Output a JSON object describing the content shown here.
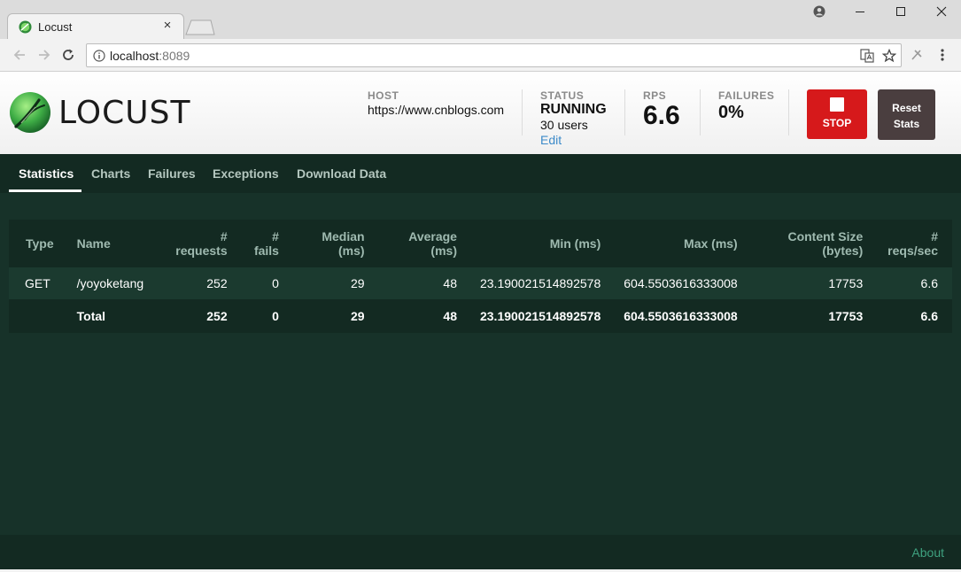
{
  "browser": {
    "tab_title": "Locust",
    "tab_close": "×",
    "url_host": "localhost",
    "url_port": ":8089"
  },
  "header": {
    "logo_text": "LOCUST",
    "host": {
      "label": "HOST",
      "value": "https://www.cnblogs.com"
    },
    "status": {
      "label": "STATUS",
      "value": "RUNNING",
      "users": "30 users",
      "edit": "Edit"
    },
    "rps": {
      "label": "RPS",
      "value": "6.6"
    },
    "failures": {
      "label": "FAILURES",
      "value": "0%"
    },
    "stop_label": "STOP",
    "reset_label_1": "Reset",
    "reset_label_2": "Stats"
  },
  "nav": {
    "tabs": [
      "Statistics",
      "Charts",
      "Failures",
      "Exceptions",
      "Download Data"
    ],
    "active": "Statistics"
  },
  "table": {
    "columns": {
      "type": "Type",
      "name": "Name",
      "requests_1": "#",
      "requests_2": "requests",
      "fails_1": "#",
      "fails_2": "fails",
      "median_1": "Median",
      "median_2": "(ms)",
      "average_1": "Average",
      "average_2": "(ms)",
      "min": "Min (ms)",
      "max": "Max (ms)",
      "content_1": "Content Size",
      "content_2": "(bytes)",
      "rps_1": "#",
      "rps_2": "reqs/sec"
    },
    "rows": [
      {
        "type": "GET",
        "name": "/yoyoketang",
        "requests": "252",
        "fails": "0",
        "median": "29",
        "average": "48",
        "min": "23.190021514892578",
        "max": "604.5503616333008",
        "content_size": "17753",
        "rps": "6.6"
      }
    ],
    "total": {
      "type": "",
      "name": "Total",
      "requests": "252",
      "fails": "0",
      "median": "29",
      "average": "48",
      "min": "23.190021514892578",
      "max": "604.5503616333008",
      "content_size": "17753",
      "rps": "6.6"
    }
  },
  "footer": {
    "about": "About"
  },
  "colors": {
    "stop": "#d6191b",
    "reset": "#4a3e3f",
    "body_bg": "#173229",
    "link": "#3d8bc9",
    "about": "#3ea17f"
  }
}
